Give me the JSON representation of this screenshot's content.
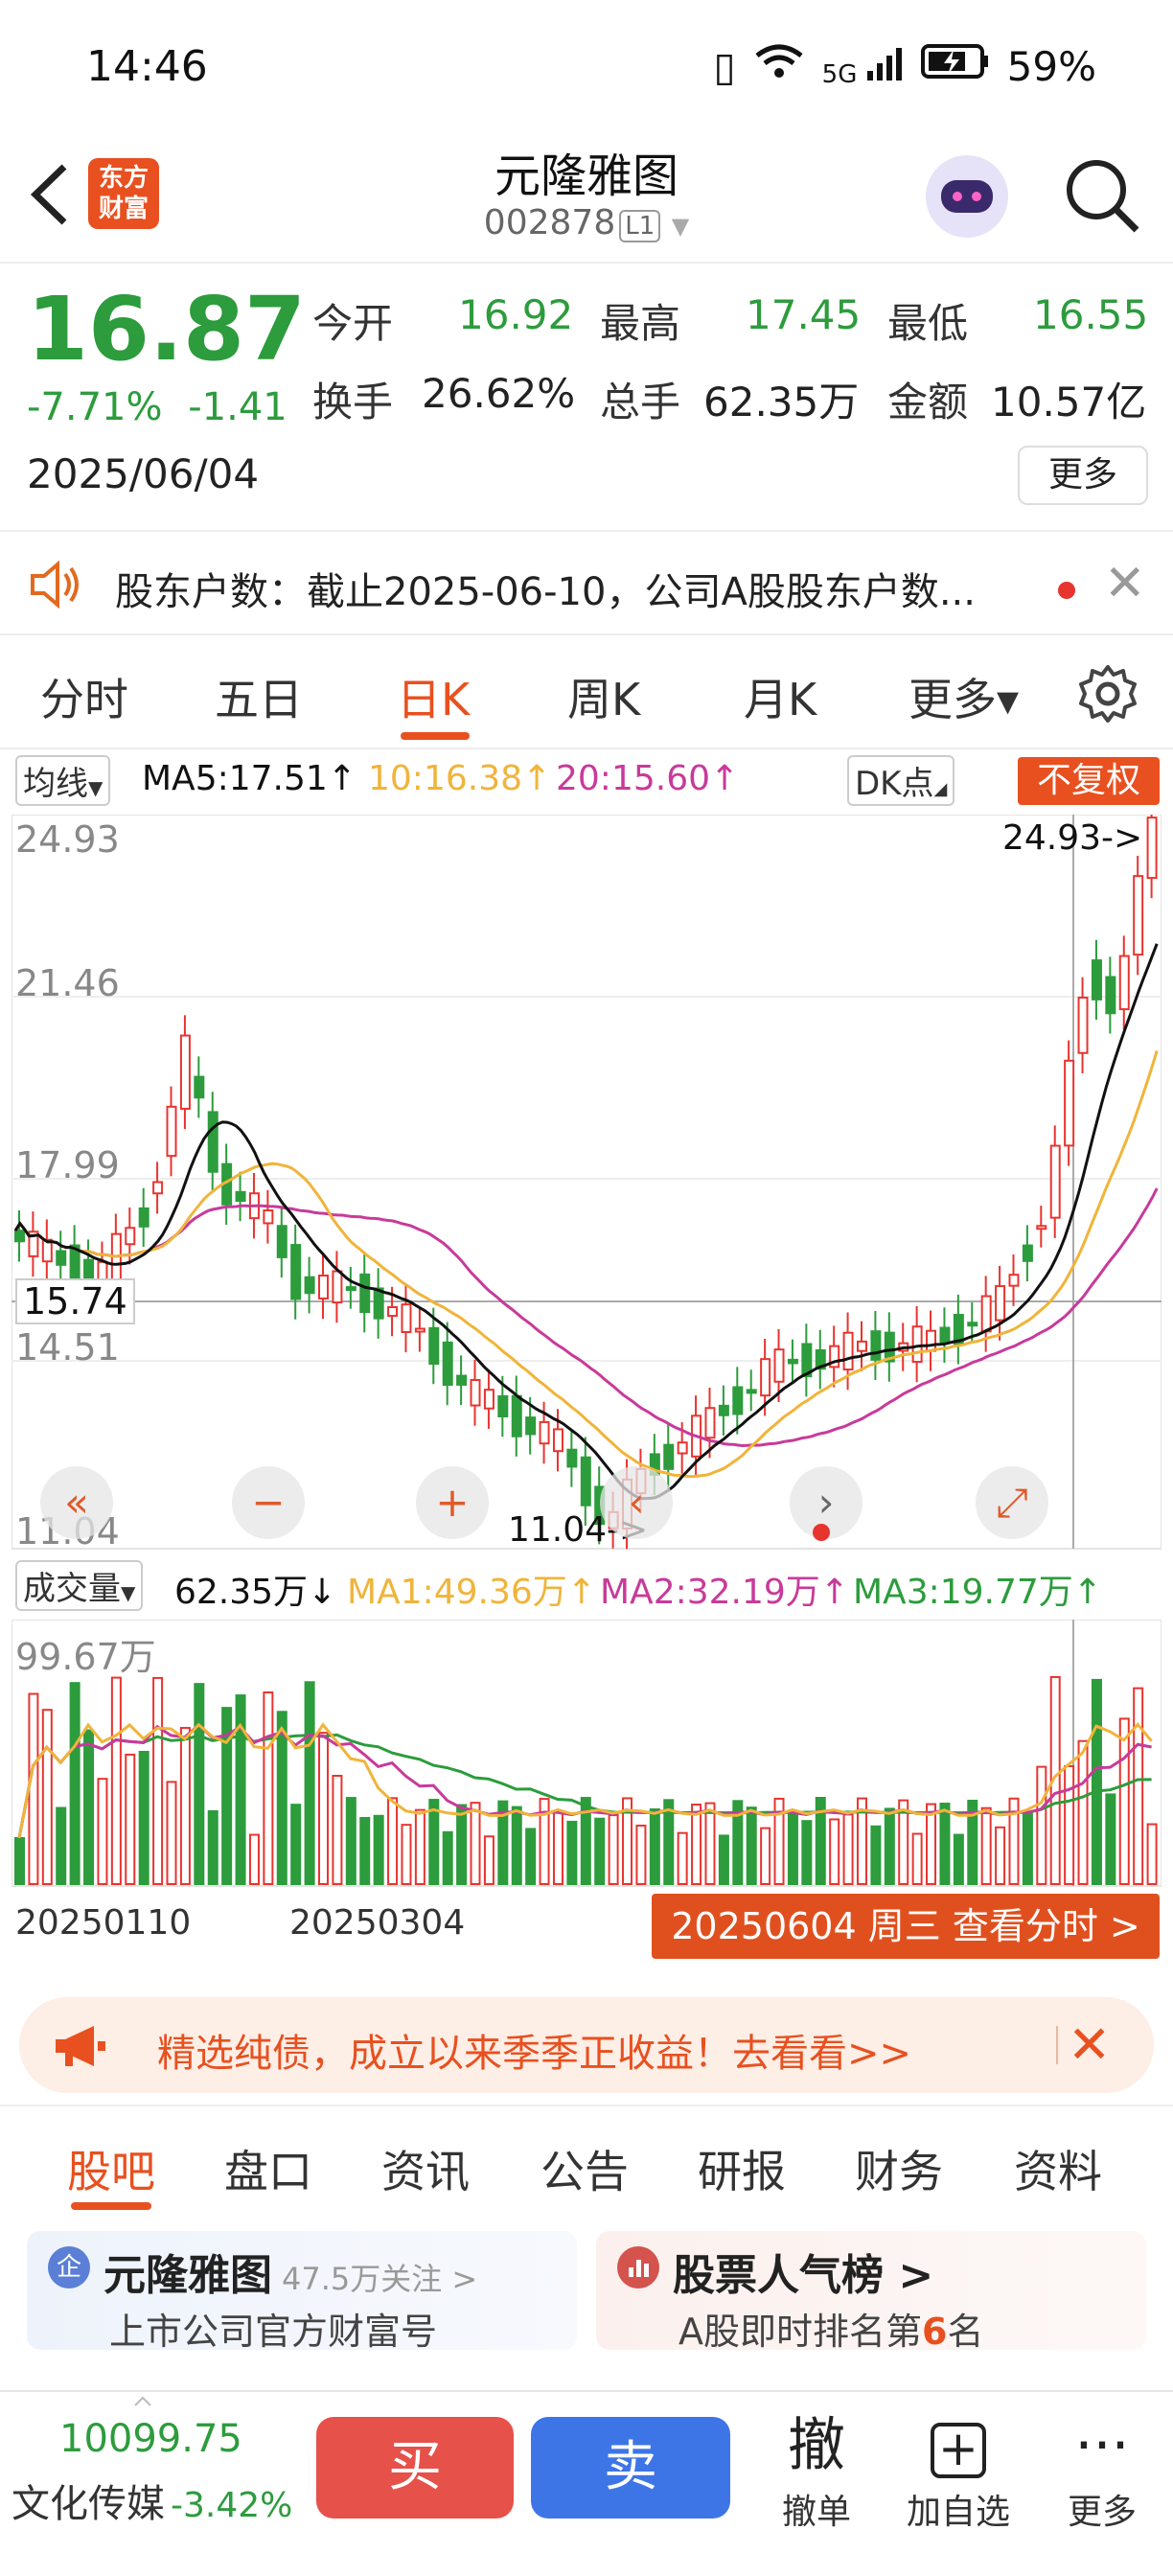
{
  "status_bar": {
    "time": "14:46",
    "network": "5G",
    "battery": "59%"
  },
  "header": {
    "logo_text": "东方财富",
    "title": "元隆雅图",
    "code": "002878",
    "level": "L1"
  },
  "quote": {
    "price": "16.87",
    "change_pct": "-7.71%",
    "change": "-1.41",
    "date": "2025/06/04",
    "open_label": "今开",
    "open": "16.92",
    "high_label": "最高",
    "high": "17.45",
    "low_label": "最低",
    "low": "16.55",
    "turnover_label": "换手",
    "turnover": "26.62%",
    "volume_label": "总手",
    "volume": "62.35万",
    "amount_label": "金额",
    "amount": "10.57亿",
    "more": "更多"
  },
  "notice": {
    "text": "股东户数：截止2025-06-10，公司A股股东户数..."
  },
  "period_tabs": [
    {
      "label": "分时"
    },
    {
      "label": "五日"
    },
    {
      "label": "日K",
      "active": true
    },
    {
      "label": "周K"
    },
    {
      "label": "月K"
    },
    {
      "label": "更多▾"
    }
  ],
  "chart_header": {
    "avg_select": "均线",
    "ma5": "MA5:17.51↑",
    "ma10": "10:16.38↑",
    "ma20": "20:15.60↑",
    "dk": "DK点",
    "adjust": "不复权"
  },
  "price_axis": [
    "24.93",
    "21.46",
    "17.99",
    "14.51",
    "11.04"
  ],
  "price_marks": {
    "max_label": "24.93->",
    "min_label": "11.04->",
    "crosshair": "15.74"
  },
  "volume_header": {
    "select": "成交量",
    "vol": "62.35万↓",
    "ma1": "MA1:49.36万↑",
    "ma2": "MA2:32.19万↑",
    "ma3": "MA3:19.77万↑",
    "axis_max": "99.67万"
  },
  "date_axis": {
    "start": "20250110",
    "mid": "20250304",
    "selected": "20250604 周三 查看分时 >"
  },
  "colors": {
    "up": "#e8342f",
    "down": "#2c9c3c",
    "accent": "#e8501f",
    "ma5": "#111111",
    "ma10": "#f0b43a",
    "ma20": "#c83a9a"
  },
  "banner": {
    "text": "精选纯债，成立以来季季正收益！去看看>>"
  },
  "sub_tabs": [
    {
      "label": "股吧",
      "active": true
    },
    {
      "label": "盘口"
    },
    {
      "label": "资讯"
    },
    {
      "label": "公告"
    },
    {
      "label": "研报"
    },
    {
      "label": "财务"
    },
    {
      "label": "资料"
    }
  ],
  "cards": [
    {
      "icon": "企",
      "title": "元隆雅图",
      "sub_title": "47.5万关注 >",
      "desc": "上市公司官方财富号"
    },
    {
      "icon": "",
      "title": "股票人气榜 >",
      "desc_prefix": "A股即时排名第",
      "rank": "6",
      "desc_suffix": "名"
    }
  ],
  "bottom_bar": {
    "index_value": "10099.75",
    "index_name": "文化传媒",
    "index_change": "-3.42%",
    "buy": "买",
    "sell": "卖",
    "cancel_icon": "撤",
    "cancel": "撤单",
    "add": "加自选",
    "more": "更多"
  }
}
